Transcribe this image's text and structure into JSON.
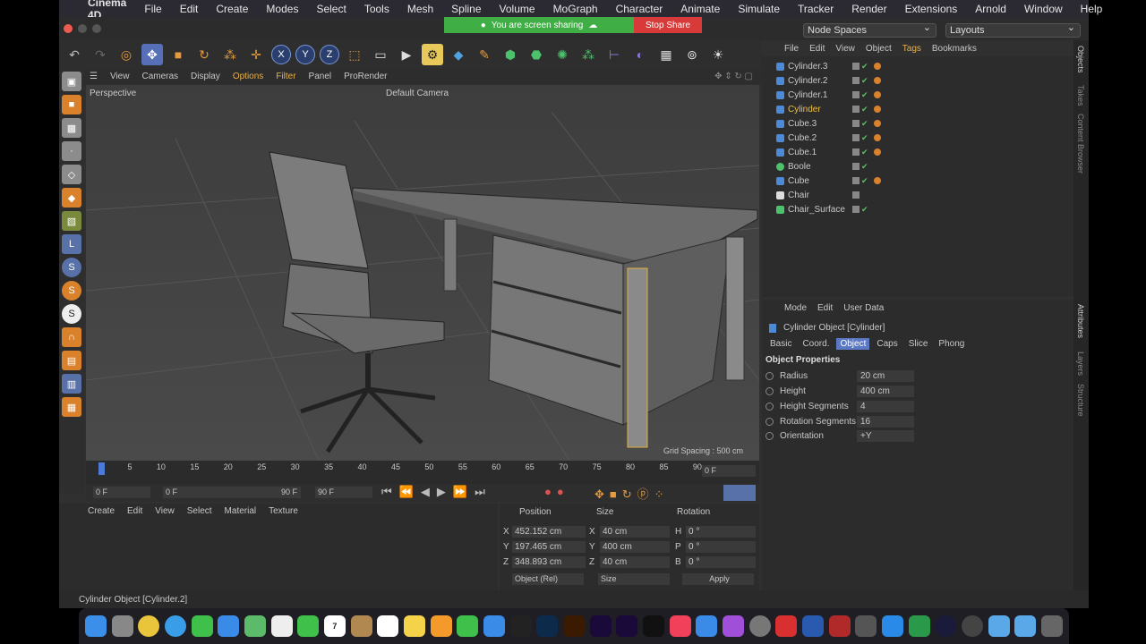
{
  "menubar": {
    "app": "Cinema 4D",
    "items": [
      "File",
      "Edit",
      "Create",
      "Modes",
      "Select",
      "Tools",
      "Mesh",
      "Spline",
      "Volume",
      "MoGraph",
      "Character",
      "Animate",
      "Simulate",
      "Tracker",
      "Render",
      "Extensions",
      "Arnold",
      "Window",
      "Help"
    ]
  },
  "share": {
    "text": "You are screen sharing",
    "stop": "Stop Share"
  },
  "title_dropdowns": {
    "nodespaces": "Node Spaces",
    "layouts": "Layouts"
  },
  "viewport": {
    "menu": [
      "View",
      "Cameras",
      "Display",
      "Options",
      "Filter",
      "Panel",
      "ProRender"
    ],
    "mode": "Perspective",
    "camera": "Default Camera",
    "grid": "Grid Spacing : 500 cm"
  },
  "timeline": {
    "ticks": [
      "0",
      "5",
      "10",
      "15",
      "20",
      "25",
      "30",
      "35",
      "40",
      "45",
      "50",
      "55",
      "60",
      "65",
      "70",
      "75",
      "80",
      "85",
      "90"
    ],
    "frame": "0 F"
  },
  "transport": {
    "start": "0 F",
    "min": "0 F",
    "max": "90 F",
    "end": "90 F"
  },
  "matmgr": {
    "menu": [
      "Create",
      "Edit",
      "View",
      "Select",
      "Material",
      "Texture"
    ]
  },
  "coords": {
    "headers": [
      "Position",
      "Size",
      "Rotation"
    ],
    "rows": [
      {
        "a": "X",
        "p": "452.152 cm",
        "b": "X",
        "s": "40 cm",
        "c": "H",
        "r": "0 °"
      },
      {
        "a": "Y",
        "p": "197.465 cm",
        "b": "Y",
        "s": "400 cm",
        "c": "P",
        "r": "0 °"
      },
      {
        "a": "Z",
        "p": "348.893 cm",
        "b": "Z",
        "s": "40 cm",
        "c": "B",
        "r": "0 °"
      }
    ],
    "mode": "Object (Rel)",
    "size_mode": "Size",
    "apply": "Apply"
  },
  "status": "Cylinder Object [Cylinder.2]",
  "objects": {
    "menu": [
      "File",
      "Edit",
      "View",
      "Object",
      "Tags",
      "Bookmarks"
    ],
    "items": [
      "Cylinder.3",
      "Cylinder.2",
      "Cylinder.1",
      "Cylinder",
      "Cube.3",
      "Cube.2",
      "Cube.1",
      "Boole",
      "Cube",
      "Chair",
      "Chair_Surface"
    ]
  },
  "attributes": {
    "menu": [
      "Mode",
      "Edit",
      "User Data"
    ],
    "title": "Cylinder Object [Cylinder]",
    "tabs": [
      "Basic",
      "Coord.",
      "Object",
      "Caps",
      "Slice",
      "Phong"
    ],
    "section": "Object Properties",
    "props": [
      {
        "label": "Radius",
        "value": "20 cm"
      },
      {
        "label": "Height",
        "value": "400 cm"
      },
      {
        "label": "Height Segments",
        "value": "4"
      },
      {
        "label": "Rotation Segments",
        "value": "16"
      },
      {
        "label": "Orientation",
        "value": "+Y"
      }
    ]
  },
  "rightbar": [
    "Objects",
    "Takes",
    "Content Browser",
    "Attributes",
    "Layers",
    "Structure"
  ],
  "dock": [
    "Finder",
    "Launchpad",
    "Chrome",
    "Safari",
    "Messages",
    "Mail",
    "Maps",
    "Photos",
    "FaceTime",
    "Calendar",
    "Preview",
    "Reminders",
    "Notes",
    "Pages",
    "Numbers",
    "Keynote",
    "Final Cut",
    "Ps",
    "Ai",
    "Pr",
    "Ae",
    "tv",
    "Music",
    "App Store",
    "Podcasts",
    "Settings",
    "Acrobat",
    "Word",
    "Zotero",
    "Dict",
    "Zoom",
    "Excel",
    "C4D",
    "QuickTime",
    "Downloads",
    "Applications",
    "Trash"
  ],
  "dock_date": "7"
}
